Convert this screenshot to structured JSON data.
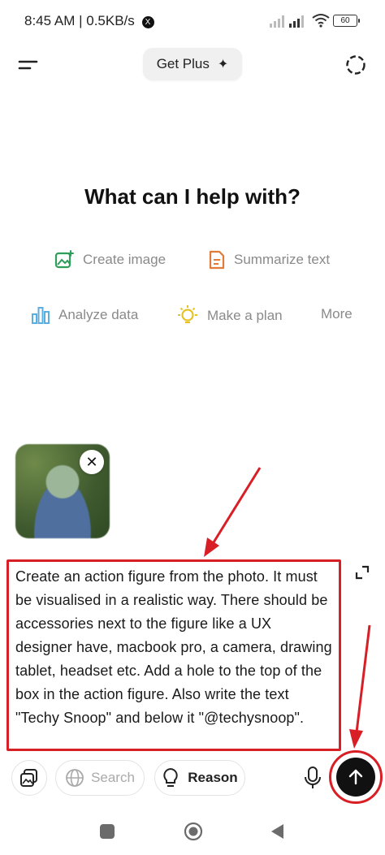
{
  "status_bar": {
    "time_speed": "8:45 AM | 0.5KB/s",
    "x_badge": "X",
    "battery": "60"
  },
  "header": {
    "get_plus_label": "Get Plus",
    "get_plus_glyph": "✦"
  },
  "main": {
    "headline": "What can I help with?",
    "suggestions": {
      "create_image": "Create image",
      "summarize_text": "Summarize text",
      "analyze_data": "Analyze data",
      "make_plan": "Make a plan",
      "more": "More"
    }
  },
  "attachment": {
    "close_glyph": "✕"
  },
  "composer": {
    "prompt_text": "Create an action figure from the photo. It must be visualised in a realistic way. There should be accessories next to the figure like a UX designer have, macbook pro, a camera, drawing tablet, headset etc. Add a hole to the top of the box in the action figure. Also write the text \"Techy Snoop\" and below it \"@techysnoop\"."
  },
  "toolbar": {
    "search_label": "Search",
    "reason_label": "Reason"
  },
  "colors": {
    "highlight_red": "#d81f26",
    "create_image_icon": "#2e9e5b",
    "summarize_icon": "#e07b39",
    "analyze_icon": "#5aaee0",
    "plan_icon": "#e6c229",
    "send_button": "#111111"
  },
  "icons": [
    "menu-icon",
    "new-chat-icon",
    "create-image-icon",
    "summarize-text-icon",
    "analyze-data-icon",
    "lightbulb-icon",
    "expand-icon",
    "attach-icon",
    "globe-icon",
    "microphone-icon",
    "arrow-up-icon"
  ]
}
